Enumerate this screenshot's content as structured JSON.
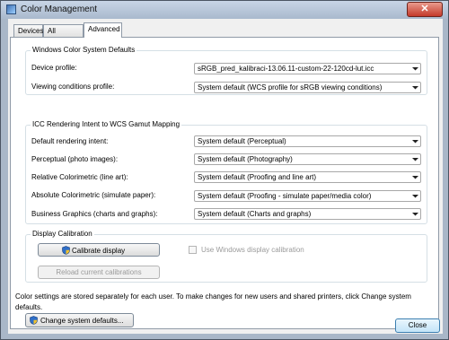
{
  "window": {
    "title": "Color Management",
    "close_label": "✕"
  },
  "tabs": [
    {
      "label": "Devices"
    },
    {
      "label": "All Profiles"
    },
    {
      "label": "Advanced"
    }
  ],
  "wcs_defaults": {
    "label": "Windows Color System Defaults",
    "device_profile_label": "Device profile:",
    "device_profile_value": "sRGB_pred_kalibraci-13.06.11-custom-22-120cd-lut.icc",
    "viewing_label": "Viewing conditions profile:",
    "viewing_value": "System default (WCS profile for sRGB viewing conditions)"
  },
  "icc_mapping": {
    "label": "ICC Rendering Intent to WCS Gamut Mapping",
    "rows": [
      {
        "label": "Default rendering intent:",
        "value": "System default (Perceptual)"
      },
      {
        "label": "Perceptual (photo images):",
        "value": "System default (Photography)"
      },
      {
        "label": "Relative Colorimetric (line art):",
        "value": "System default (Proofing and line art)"
      },
      {
        "label": "Absolute Colorimetric (simulate paper):",
        "value": "System default (Proofing - simulate paper/media color)"
      },
      {
        "label": "Business Graphics (charts and graphs):",
        "value": "System default (Charts and graphs)"
      }
    ]
  },
  "calibration": {
    "label": "Display Calibration",
    "calibrate_button": "Calibrate display",
    "reload_button": "Reload current calibrations",
    "use_windows_calibration": "Use Windows display calibration"
  },
  "note": "Color settings are stored separately for each user. To make changes for new users and shared printers, click Change system defaults.",
  "change_defaults_button": "Change system defaults...",
  "close_button": "Close"
}
